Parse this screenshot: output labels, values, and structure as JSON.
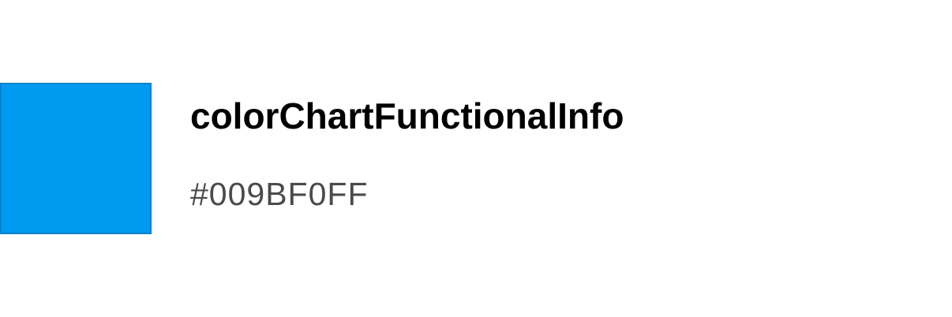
{
  "token": {
    "name": "colorChartFunctionalInfo",
    "value": "#009BF0FF",
    "swatch_color": "#009BF0",
    "swatch_border_color": "#0080CC"
  }
}
